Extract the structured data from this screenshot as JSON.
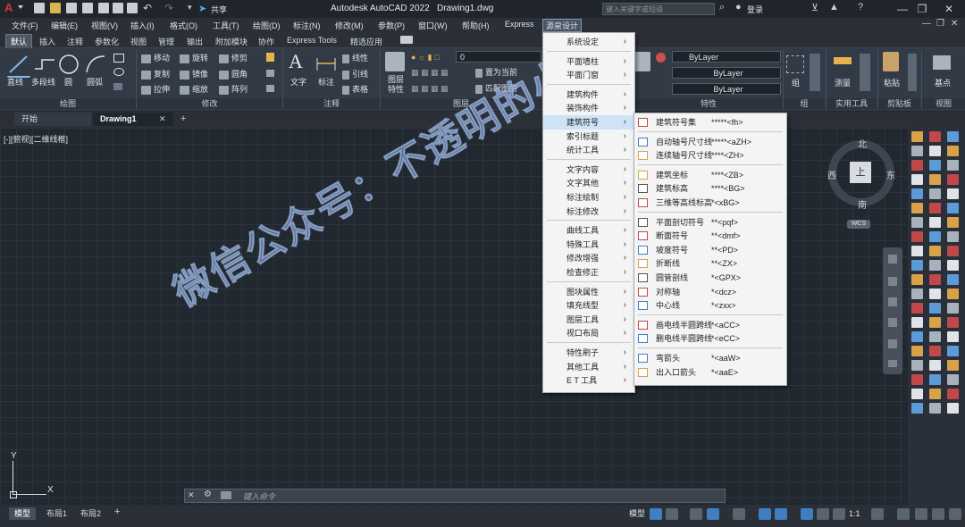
{
  "app": {
    "title": "Autodesk AutoCAD 2022",
    "file": "Drawing1.dwg",
    "share": "共享",
    "search_placeholder": "键入关键字或短语",
    "login": "登录"
  },
  "menubar": [
    "文件(F)",
    "编辑(E)",
    "视图(V)",
    "插入(I)",
    "格式(O)",
    "工具(T)",
    "绘图(D)",
    "标注(N)",
    "修改(M)",
    "参数(P)",
    "窗口(W)",
    "帮助(H)",
    "Express",
    "源泉设计"
  ],
  "ribbon_tabs": [
    "默认",
    "插入",
    "注释",
    "参数化",
    "视图",
    "管理",
    "输出",
    "附加模块",
    "协作",
    "Express Tools",
    "精选应用"
  ],
  "ribbon": {
    "draw": {
      "title": "绘图",
      "big": [
        "直线",
        "多段线",
        "圆",
        "圆弧"
      ]
    },
    "modify": {
      "title": "修改",
      "rows": [
        [
          "移动",
          "旋转",
          "修剪"
        ],
        [
          "复制",
          "镜像",
          "圆角"
        ],
        [
          "拉伸",
          "缩放",
          "阵列"
        ]
      ]
    },
    "annotation": {
      "title": "注释",
      "big": [
        "文字",
        "标注"
      ],
      "small": [
        "线性",
        "引线",
        "表格"
      ]
    },
    "layers": {
      "title": "图层",
      "big": "图层特性",
      "layer_value": "0",
      "small": [
        "置为当前",
        "匹配图层"
      ]
    },
    "properties": {
      "title": "特性",
      "match": "特性匹配",
      "values": [
        "ByLayer",
        "ByLayer",
        "ByLayer"
      ]
    },
    "groups": {
      "title": "组",
      "label": "组"
    },
    "utilities": {
      "title": "实用工具",
      "label": "测量"
    },
    "clipboard": {
      "title": "剪贴板",
      "label": "粘贴"
    },
    "view": {
      "title": "视图",
      "label": "基点"
    }
  },
  "file_tabs": [
    "开始",
    "Drawing1"
  ],
  "viewport_label": "[-][俯视][二维线框]",
  "compass": {
    "north": "北",
    "south": "南",
    "east": "东",
    "west": "西",
    "top": "上",
    "wcs": "WCS"
  },
  "ucs": {
    "x": "X",
    "y": "Y"
  },
  "command": {
    "placeholder": "键入命令"
  },
  "status": {
    "tabs": [
      "模型",
      "布局1",
      "布局2"
    ],
    "model_label": "模型",
    "scale": "1:1"
  },
  "watermark": "微信公众号：不透明的小乐",
  "menu_main": {
    "groups": [
      [
        "系统设定"
      ],
      [
        "平面墙柱",
        "平面门窗"
      ],
      [
        "建筑构件",
        "装饰构件",
        "建筑符号",
        "索引标题",
        "统计工具"
      ],
      [
        "文字内容",
        "文字其他",
        "标注绘制",
        "标注修改"
      ],
      [
        "曲线工具",
        "特殊工具",
        "修改增强",
        "检查修正"
      ],
      [
        "图块属性",
        "填充线型",
        "图层工具",
        "视口布局"
      ],
      [
        "特性刷子",
        "其他工具",
        "E T 工具"
      ]
    ],
    "highlighted": "建筑符号"
  },
  "menu_sub": {
    "groups": [
      [
        {
          "label": "建筑符号集",
          "shortcut": "*****<fh>"
        }
      ],
      [
        {
          "label": "自动轴号尺寸线",
          "shortcut": "*****<aZH>"
        },
        {
          "label": "连续轴号尺寸线",
          "shortcut": "****<ZH>"
        }
      ],
      [
        {
          "label": "建筑坐标",
          "shortcut": "****<ZB>"
        },
        {
          "label": "建筑标高",
          "shortcut": "****<BG>"
        },
        {
          "label": "三维等高线标高",
          "shortcut": "*<xBG>"
        }
      ],
      [
        {
          "label": "平面剖切符号",
          "shortcut": "**<pqf>"
        },
        {
          "label": "断面符号",
          "shortcut": "**<dmf>"
        },
        {
          "label": "坡度符号",
          "shortcut": "**<PD>"
        },
        {
          "label": "折断线",
          "shortcut": "**<ZX>"
        },
        {
          "label": "圆管剖线",
          "shortcut": "*<GPX>"
        },
        {
          "label": "对称轴",
          "shortcut": "*<dcz>"
        },
        {
          "label": "中心线",
          "shortcut": "*<zxx>"
        }
      ],
      [
        {
          "label": "画电线半圆跨线",
          "shortcut": "*<aCC>"
        },
        {
          "label": "删电线半圆跨线",
          "shortcut": "*<eCC>"
        }
      ],
      [
        {
          "label": "弯箭头",
          "shortcut": "*<aaW>"
        },
        {
          "label": "出入口箭头",
          "shortcut": "*<aaE>"
        }
      ]
    ]
  },
  "colors": {
    "canvas": "#212830",
    "ribbon": "#323a45",
    "menu_bg": "#f4f4f4",
    "menu_highlight": "#cfe3f7",
    "logo": "#e03333"
  }
}
